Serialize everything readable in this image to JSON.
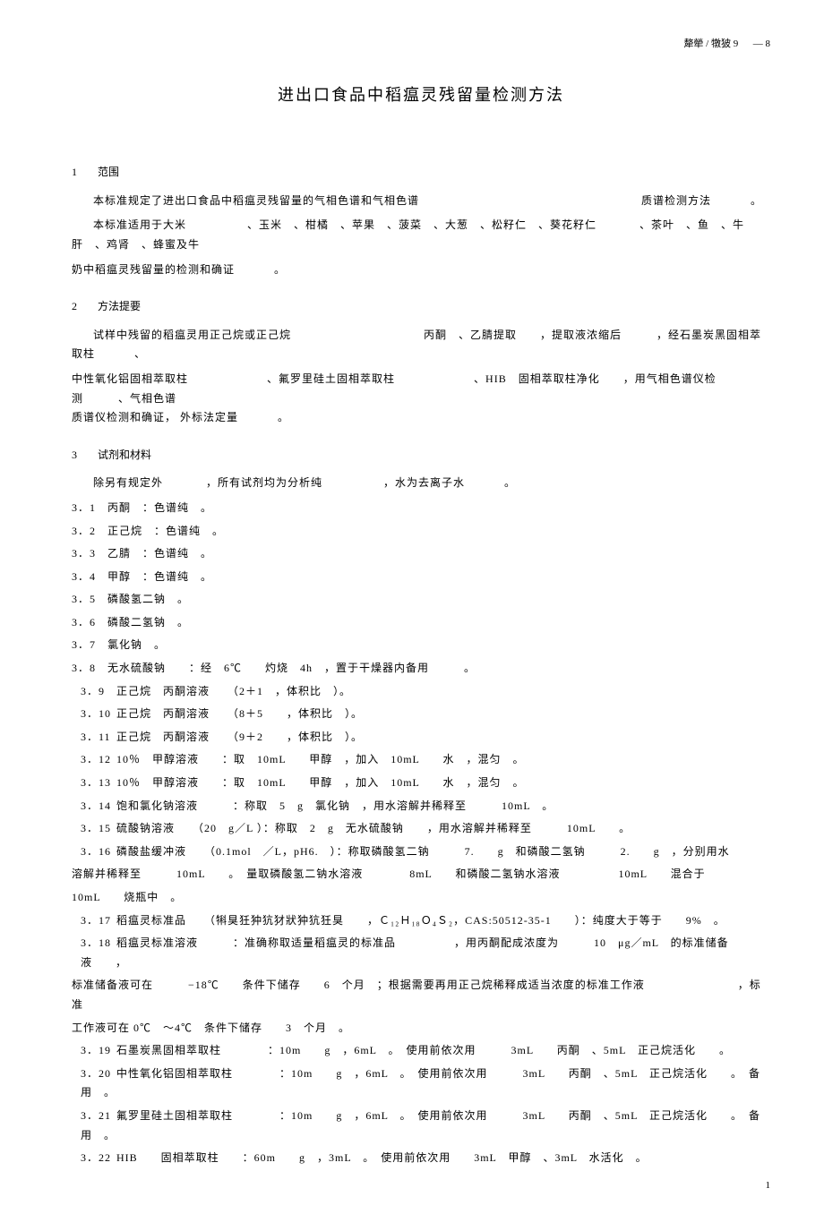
{
  "header": {
    "code": "犛犖 / 犜狓 9 　 — 8"
  },
  "title": "进出口食品中稻瘟灵残留量检测方法",
  "sections": {
    "s1": {
      "num": "1",
      "title": "范围"
    },
    "s2": {
      "num": "2",
      "title": "方法提要"
    },
    "s3": {
      "num": "3",
      "title": "试剂和材料"
    }
  },
  "body": {
    "p1": "本标准规定了进出口食品中稻瘟灵残留量的气相色谱和气相色谱",
    "p1b": "质谱检测方法",
    "p2a": "本标准适用于大米",
    "p2b": "、玉米　、柑橘　、苹果　、菠菜　、大葱　、松籽仁　、葵花籽仁",
    "p2c": "、茶叶　、鱼　、牛肝　、鸡肾　、蜂蜜及牛",
    "p2bold": "奶中稻瘟灵残留量的检测和确证",
    "p3a": "试样中残留的稻瘟灵用正己烷或正己烷",
    "p3b": "丙酮　、乙腈提取　　，提取液浓缩后　　　，经石墨炭黑固相萃取柱",
    "p3c": "中性氧化铝固相萃取柱",
    "p3d": "、氟罗里硅土固相萃取柱",
    "p3e": "、HIB　固相萃取柱净化　　，用气相色谱仪检测　　　、气相色谱",
    "p3bold": "质谱仪检测和确证，",
    "p3f": "外标法定量",
    "p4a": "除另有规定外",
    "p4b": "，所有试剂均为分析纯",
    "p4c": "，水为去离子水"
  },
  "items": {
    "i1": {
      "n": "3．1",
      "t": "丙酮　：色谱纯　。"
    },
    "i2": {
      "n": "3．2",
      "t": "正己烷　：色谱纯　。"
    },
    "i3": {
      "n": "3．3",
      "t": "乙腈　：色谱纯　。"
    },
    "i4": {
      "n": "3．4",
      "t": "甲醇　：色谱纯　。"
    },
    "i5": {
      "n": "3．5",
      "t": "磷酸氢二钠　。"
    },
    "i6": {
      "n": "3．6",
      "t": "磷酸二氢钠　。"
    },
    "i7": {
      "n": "3．7",
      "t": "氯化钠　。"
    },
    "i8": {
      "n": "3．8",
      "t": "无水硫酸钠　　：经　6℃　　灼烧　4h　，置于干燥器内备用　　　。"
    },
    "i9": {
      "n": "3．9",
      "t": "正己烷　丙酮溶液　　（2＋1　，体积比　）。"
    },
    "i10": {
      "n": "3．10",
      "t": "正己烷　丙酮溶液　　（8＋5　　，体积比　）。"
    },
    "i11": {
      "n": "3．11",
      "t": "正己烷　丙酮溶液　　（9＋2　　，体积比　）。"
    },
    "i12": {
      "n": "3．12",
      "t": "10％　甲醇溶液　　：取　10mL　　甲醇　，加入　10mL　　水　，混匀　。"
    },
    "i13": {
      "n": "3．13",
      "t": "10％　甲醇溶液　　：取　10mL　　甲醇　，加入　10mL　　水　，混匀　。"
    },
    "i14": {
      "n": "3．14",
      "t": "饱和氯化钠溶液　　　：称取　5　g　氯化钠　，用水溶解并稀释至　　　10mL　。"
    },
    "i15": {
      "n": "3．15",
      "t": "硫酸钠溶液　　（20　g／L ）：称取　2　g　无水硫酸钠　　，用水溶解并稀释至　　　10mL　　。"
    },
    "i16a": {
      "n": "3．16",
      "t": "磷酸盐缓冲液　　（0.1mol　／L，pH6.　）：称取磷酸氢二钠　　　7.　　g　和磷酸二氢钠　　　2.　　g　，分别用水"
    },
    "i16b": "溶解并稀释至　　　10mL　　。　量取磷酸氢二钠水溶液　　　　8mL　　和磷酸二氢钠水溶液　　　　　10mL　　混合于",
    "i16c": "10mL　　烧瓶中　。",
    "i17": {
      "n": "3．17",
      "t": "稻瘟灵标准品　　（犐狊狅狆犺犲狀狆犺狅狊　　，Ｃ₁₂Ｈ₁₈Ｏ₄Ｓ₂，CAS:50512-35-1　　）：纯度大于等于　　9%　。"
    },
    "i18a": {
      "n": "3．18",
      "t": "稻瘟灵标准溶液　　　：准确称取适量稻瘟灵的标准品　　　　　，用丙酮配成浓度为　　　10　μg／mL　的标准储备液　　，"
    },
    "i18b": "标准储备液可在　　　−18℃　　条件下储存　　6　个月　；根据需要再用正己烷稀释成适当浓度的标准工作液　　　　　　　　，标准",
    "i18c": "工作液可在 0℃　～4℃　条件下储存　　3　个月　。",
    "i19": {
      "n": "3．19",
      "t": "石墨炭黑固相萃取柱　　　　：10m　　g　，6mL　。　使用前依次用　　　3mL　　丙酮　、5mL　正己烷活化　　。"
    },
    "i20": {
      "n": "3．20",
      "t": "中性氧化铝固相萃取柱　　　　：10m　　g　，6mL　。　使用前依次用　　　3mL　　丙酮　、5mL　正己烷活化　　。　备用　。"
    },
    "i21": {
      "n": "3．21",
      "t": "氟罗里硅土固相萃取柱　　　　：10m　　g　，6mL　。　使用前依次用　　　3mL　　丙酮　、5mL　正己烷活化　　。　备用　。"
    },
    "i22": {
      "n": "3．22",
      "t": "HIB　　固相萃取柱　　：60m　　g　，3mL　。　使用前依次用　　3mL　甲醇　、3mL　水活化　。"
    }
  },
  "footer": {
    "page": "1"
  }
}
